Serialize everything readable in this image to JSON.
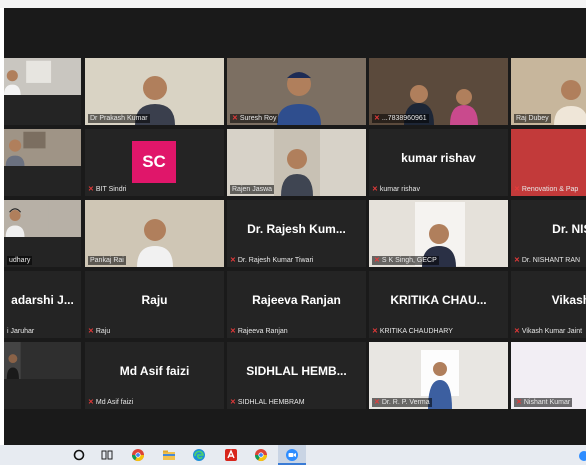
{
  "participants": [
    {
      "label": "",
      "big": "",
      "mic_muted": false,
      "video": "office-white"
    },
    {
      "label": "Dr Prakash Kumar",
      "big": "",
      "mic_muted": false,
      "video": "man-glasses-light"
    },
    {
      "label": "Suresh Roy",
      "big": "",
      "mic_muted": true,
      "video": "man-cap-blue"
    },
    {
      "label": "...7838960961",
      "big": "",
      "mic_muted": true,
      "video": "couple-office"
    },
    {
      "label": "Raj Dubey",
      "big": "",
      "mic_muted": false,
      "video": "man-office-warm"
    },
    {
      "label": "",
      "big": "",
      "mic_muted": false,
      "video": "man-shelves"
    },
    {
      "label": "BIT Sindri",
      "big": "",
      "mic_muted": true,
      "avatar": "SC",
      "avatar_color": "#e0166a"
    },
    {
      "label": "Rajen Jaswa",
      "big": "",
      "mic_muted": false,
      "video": "man-suit-photo"
    },
    {
      "label": "kumar rishav",
      "big": "kumar rishav",
      "mic_muted": true,
      "video": ""
    },
    {
      "label": "Renovation & Pap",
      "big": "",
      "mic_muted": true,
      "video": "man-red-bg"
    },
    {
      "label": "udhary",
      "big": "",
      "mic_muted": false,
      "video": "man-headset"
    },
    {
      "label": "Pankaj Rai",
      "big": "",
      "mic_muted": false,
      "video": "man-speaking",
      "active": true
    },
    {
      "label": "Dr. Rajesh Kumar Tiwari",
      "big": "Dr. Rajesh Kum...",
      "mic_muted": true,
      "video": ""
    },
    {
      "label": "S K Singh, GECP",
      "big": "",
      "mic_muted": true,
      "video": "man-portrait"
    },
    {
      "label": "Dr. NISHANT RAN",
      "big": "Dr. NISHA",
      "mic_muted": true,
      "video": ""
    },
    {
      "label": "i Jaruhar",
      "big": "adarshi J...",
      "mic_muted": false,
      "video": ""
    },
    {
      "label": "Raju",
      "big": "Raju",
      "mic_muted": true,
      "video": ""
    },
    {
      "label": "Rajeeva Ranjan",
      "big": "Rajeeva Ranjan",
      "mic_muted": true,
      "video": ""
    },
    {
      "label": "KRITIKA CHAUDHARY",
      "big": "KRITIKA  CHAU...",
      "mic_muted": true,
      "video": ""
    },
    {
      "label": "Vikash Kumar Jaint",
      "big": "Vikash Ku",
      "mic_muted": true,
      "video": ""
    },
    {
      "label": "",
      "big": "",
      "mic_muted": false,
      "video": "man-dark"
    },
    {
      "label": "Md Asif faizi",
      "big": "Md Asif faizi",
      "mic_muted": true,
      "video": ""
    },
    {
      "label": "SIDHLAL HEMBRAM",
      "big": "SIDHLAL  HEMB...",
      "mic_muted": true,
      "video": ""
    },
    {
      "label": "Dr. R. P. Verma",
      "big": "",
      "mic_muted": true,
      "video": "man-id-photo"
    },
    {
      "label": "Nishant Kumar",
      "big": "",
      "mic_muted": true,
      "video": "cartoon-owl"
    }
  ],
  "taskbar": {
    "icons": [
      "search-icon",
      "task-view-icon",
      "chrome-icon",
      "file-explorer-icon",
      "edge-icon",
      "acrobat-icon",
      "chrome-icon",
      "zoom-icon"
    ]
  }
}
